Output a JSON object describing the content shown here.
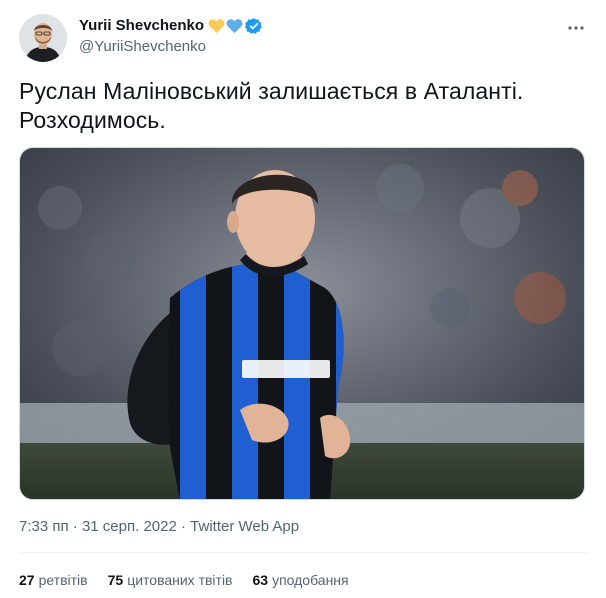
{
  "author": {
    "name": "Yurii Shevchenko",
    "handle": "@YuriiShevchenko",
    "hearts": [
      {
        "icon": "yellow-heart-icon",
        "color": "#fdcb58"
      },
      {
        "icon": "blue-heart-icon",
        "color": "#5dadec"
      }
    ],
    "verified_icon": "verified-badge-icon",
    "verified_color": "#1d9bf0"
  },
  "menu": {
    "icon": "more-horizontal-icon"
  },
  "tweet": {
    "text_lines": [
      "Руслан Маліновський залишається в Аталанті.",
      "Розходимось."
    ]
  },
  "meta": {
    "time": "7:33 пп",
    "separator1": " · ",
    "date": "31 серп. 2022",
    "separator2": " · ",
    "source": "Twitter Web App"
  },
  "stats": {
    "retweets": {
      "count": "27",
      "label": "ретвітів"
    },
    "quotes": {
      "count": "75",
      "label": "цитованих твітів"
    },
    "likes": {
      "count": "63",
      "label": "уподобання"
    }
  },
  "colors": {
    "text": "#0f1419",
    "secondary": "#536471",
    "kit_blue": "#1f5fd1",
    "kit_black": "#111418"
  }
}
